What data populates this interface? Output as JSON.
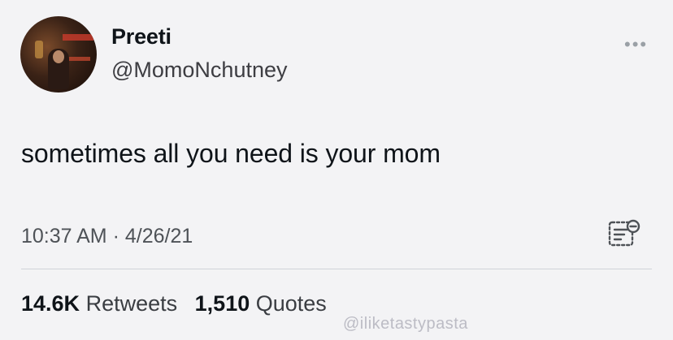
{
  "user": {
    "display_name": "Preeti",
    "handle": "@MomoNchutney",
    "avatar_icon": "profile-photo"
  },
  "menu": {
    "icon": "more-horizontal-icon",
    "glyph": "•••"
  },
  "tweet": {
    "text": "sometimes all you need is your mom",
    "timestamp": "10:37 AM · 4/26/21"
  },
  "analytics": {
    "icon": "analytics-icon"
  },
  "stats": {
    "retweets_count": "14.6K",
    "retweets_label": "Retweets",
    "quotes_count": "1,510",
    "quotes_label": "Quotes"
  },
  "watermark": {
    "text": "@iliketastypasta"
  }
}
